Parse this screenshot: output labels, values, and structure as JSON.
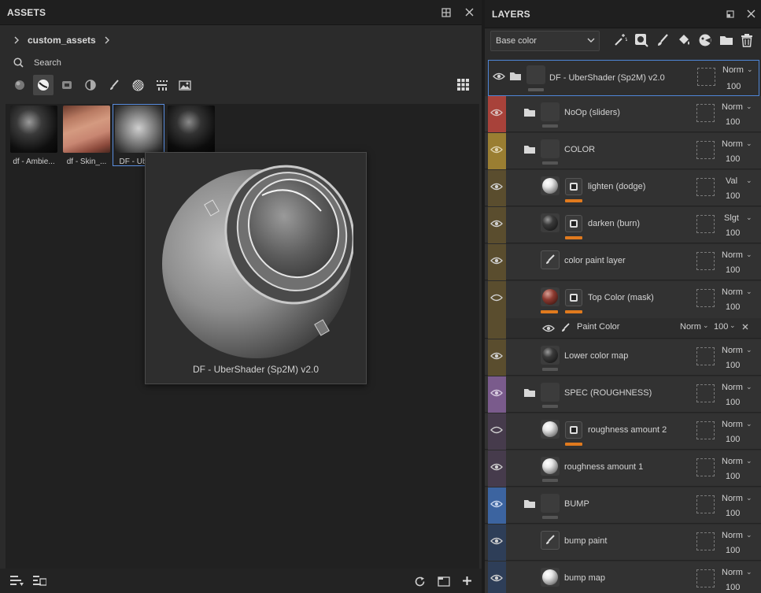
{
  "assets": {
    "title": "ASSETS",
    "breadcrumb": "custom_assets",
    "search_placeholder": "Search",
    "thumbnails": [
      {
        "label": "df - Ambie..."
      },
      {
        "label": "df - Skin_..."
      },
      {
        "label": "DF - Ube..."
      },
      {
        "label": ""
      }
    ],
    "preview_title": "DF - UberShader (Sp2M) v2.0"
  },
  "layers": {
    "title": "LAYERS",
    "channel": "Base color",
    "rows": [
      {
        "name": "DF - UberShader (Sp2M) v2.0",
        "blend": "Norm",
        "opacity": "100"
      },
      {
        "name": "NoOp (sliders)",
        "blend": "Norm",
        "opacity": "100"
      },
      {
        "name": "COLOR",
        "blend": "Norm",
        "opacity": "100"
      },
      {
        "name": "lighten (dodge)",
        "blend": "Val",
        "opacity": "100"
      },
      {
        "name": "darken (burn)",
        "blend": "Slgt",
        "opacity": "100"
      },
      {
        "name": "color paint layer",
        "blend": "Norm",
        "opacity": "100"
      },
      {
        "name": "Top Color (mask)",
        "blend": "Norm",
        "opacity": "100"
      },
      {
        "name": "Lower color map",
        "blend": "Norm",
        "opacity": "100"
      },
      {
        "name": "SPEC (ROUGHNESS)",
        "blend": "Norm",
        "opacity": "100"
      },
      {
        "name": "roughness amount 2",
        "blend": "Norm",
        "opacity": "100"
      },
      {
        "name": "roughness amount 1",
        "blend": "Norm",
        "opacity": "100"
      },
      {
        "name": "BUMP",
        "blend": "Norm",
        "opacity": "100"
      },
      {
        "name": "bump paint",
        "blend": "Norm",
        "opacity": "100"
      },
      {
        "name": "bump map",
        "blend": "Norm",
        "opacity": "100"
      }
    ],
    "effect": {
      "name": "Paint Color",
      "blend": "Norm",
      "opacity": "100"
    }
  },
  "colors": {
    "group_red": "#a8423a",
    "group_olive": "#5a4d2e",
    "group_color": "#9a7e32",
    "group_purple": "#7a5b8c",
    "group_spec": "#463b4c",
    "group_blue": "#3c64a0",
    "group_bump": "#2e3e58",
    "accent_orange": "#e07a1e",
    "selection_blue": "#4f86d8"
  }
}
